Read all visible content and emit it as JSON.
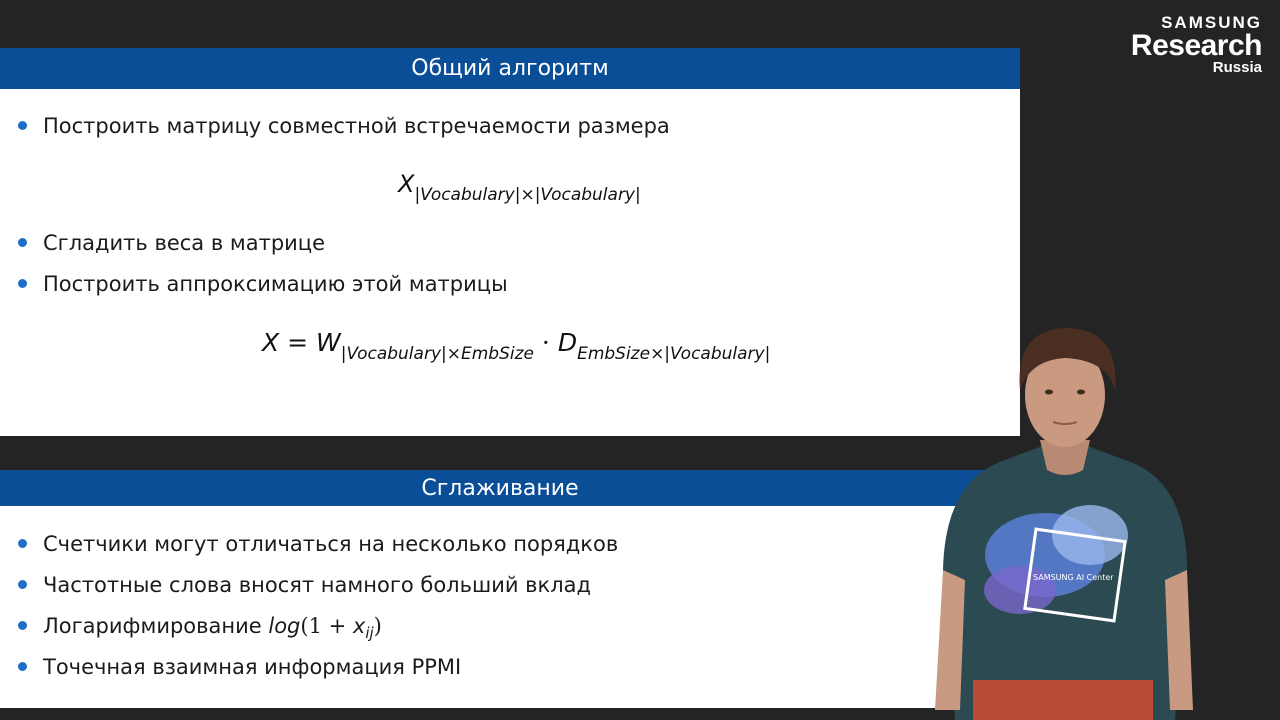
{
  "logo": {
    "line1": "SAMSUNG",
    "line2": "Research",
    "line3": "Russia"
  },
  "slide1": {
    "title": "Общий алгоритм",
    "bullets": [
      "Построить матрицу совместной встречаемости размера",
      "Сгладить веса в матрице",
      "Построить аппроксимацию этой матрицы"
    ],
    "formula1": {
      "X": "X",
      "sub": "|Vocabulary|×|Vocabulary|"
    },
    "formula2": {
      "lhs": "X",
      "eq": " = ",
      "W": "W",
      "W_sub": "|Vocabulary|×EmbSize",
      "dot": " · ",
      "D": "D",
      "D_sub": "EmbSize×|Vocabulary|"
    }
  },
  "slide2": {
    "title": "Сглаживание",
    "bullets": [
      "Счетчики могут отличаться на несколько порядков",
      "Частотные слова вносят намного больший вклад",
      "Логарифмирование",
      "Точечная взаимная информация PPMI"
    ],
    "log_expr": {
      "fn": "log",
      "open": "(1 + ",
      "var": "x",
      "sub": "ij",
      "close": ")"
    }
  },
  "shirt_text": "SAMSUNG AI Center",
  "colors": {
    "title_bar": "#0b4e98",
    "bullet": "#1e6ec7",
    "background": "#242424"
  }
}
